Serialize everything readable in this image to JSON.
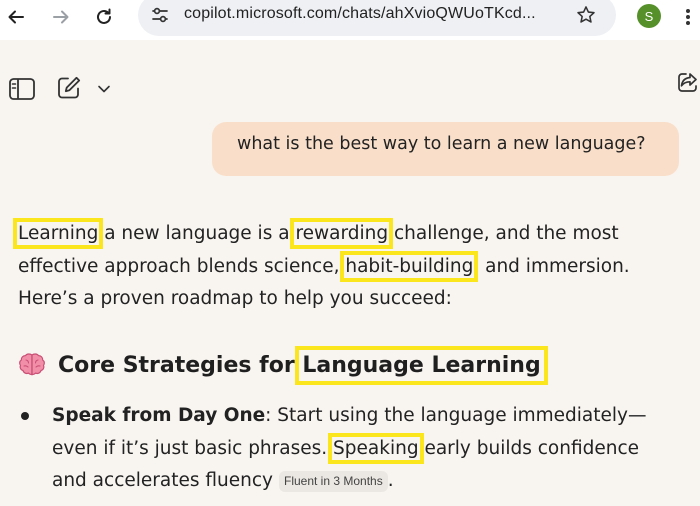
{
  "browser": {
    "url": "copilot.microsoft.com/chats/ahXvioQWUoTKcd...",
    "profile_initial": "S",
    "profile_color": "#55902a"
  },
  "icons": {
    "back": "arrow-left-icon",
    "forward": "arrow-right-icon",
    "reload": "reload-icon",
    "site_info": "tune-icon",
    "bookmark": "star-icon",
    "menu": "kebab-icon",
    "sidebar": "sidebar-toggle-icon",
    "new_chat": "compose-icon",
    "dropdown": "chevron-down-icon",
    "share": "share-icon",
    "heading_emoji": "brain-icon"
  },
  "chat": {
    "user_message": "what is the best way to learn a new language?",
    "answer_intro": {
      "w1": "Learning",
      "t1": " a new language is a ",
      "w2": "rewarding",
      "t2": " challenge, and the most effective approach blends science, ",
      "w3": "habit-building",
      "t3": ", and immersion. Here’s a proven roadmap to help you succeed:"
    },
    "heading": {
      "prefix": "Core Strategies for ",
      "highlight": "Language Learning"
    },
    "bullets": [
      {
        "title": "Speak from Day One",
        "t1": ": Start using the language immediately—even if it’s just basic phrases. ",
        "highlight": "Speaking",
        "t2": " early builds confidence and accelerates fluency",
        "chip": "Fluent in 3 Months",
        "end": "."
      }
    ]
  },
  "colors": {
    "page_bg": "#f8f5f1",
    "user_bubble": "#f9dfca",
    "highlight_box": "#fbe61e",
    "chip_bg": "#ebe7e2"
  }
}
